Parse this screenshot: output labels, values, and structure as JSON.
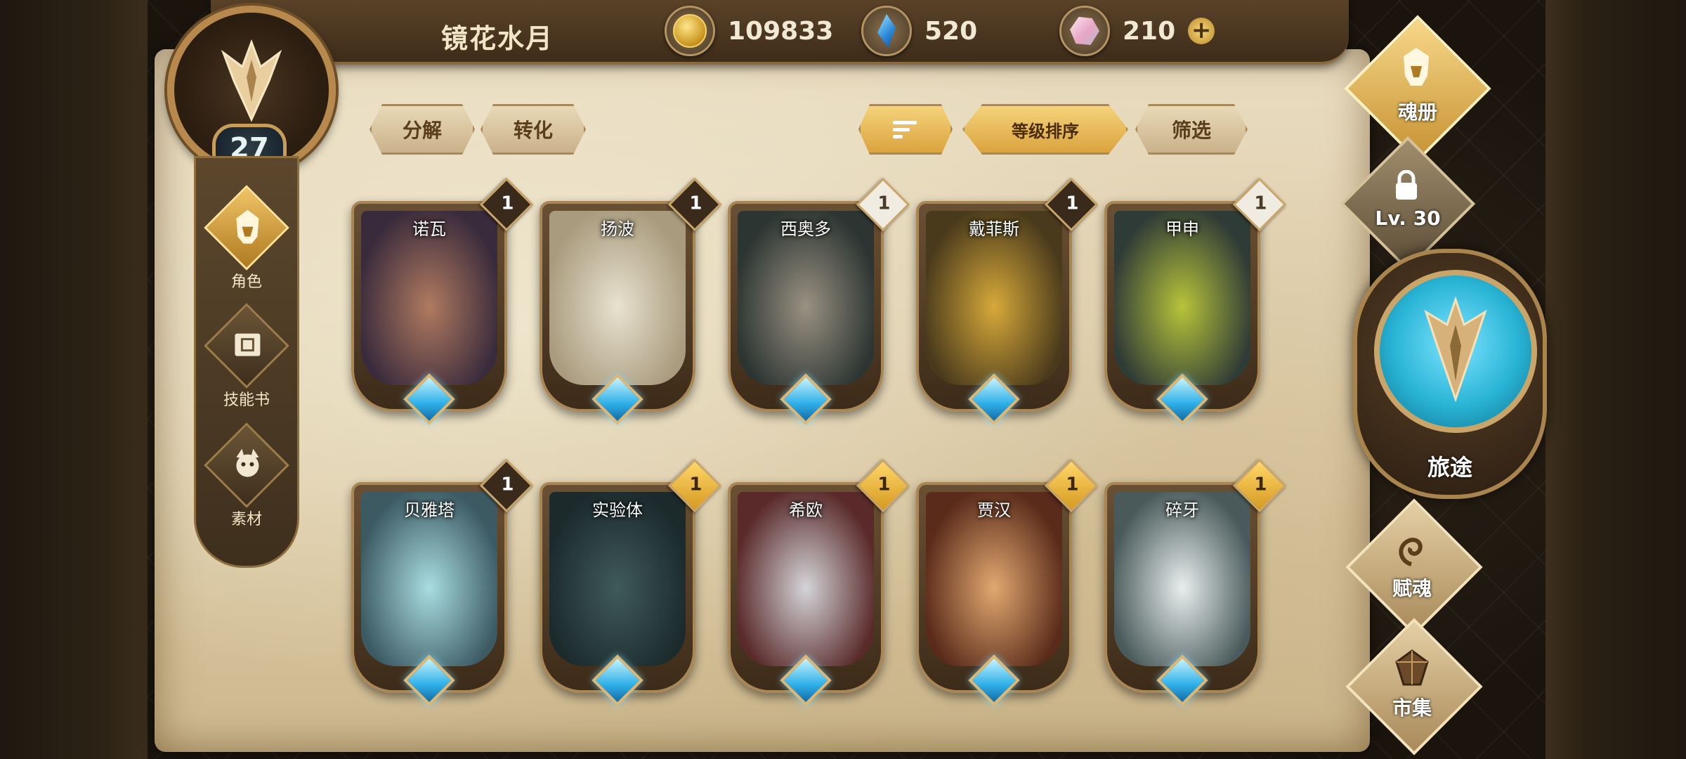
{
  "header": {
    "player_name": "镜花水月",
    "gold": "109833",
    "crystal": "520",
    "gem": "210",
    "level": "27"
  },
  "left_nav": [
    {
      "label": "角色",
      "icon": "helmet-icon",
      "active": true
    },
    {
      "label": "技能书",
      "icon": "book-icon",
      "active": false
    },
    {
      "label": "素材",
      "icon": "material-icon",
      "active": false
    }
  ],
  "actions": {
    "decompose": "分解",
    "convert": "转化",
    "sort_level": "等级排序",
    "filter": "筛选"
  },
  "cards_row1": [
    {
      "name": "诺瓦",
      "level": "1",
      "badge": "dark",
      "palette": [
        "#3a2b3c",
        "#b07a60"
      ]
    },
    {
      "name": "扬波",
      "level": "1",
      "badge": "dark",
      "palette": [
        "#a99b7e",
        "#e8e2cf"
      ]
    },
    {
      "name": "西奥多",
      "level": "1",
      "badge": "white",
      "palette": [
        "#2c3532",
        "#9a9182"
      ]
    },
    {
      "name": "戴菲斯",
      "level": "1",
      "badge": "dark",
      "palette": [
        "#4a3a1c",
        "#d6a93a"
      ]
    },
    {
      "name": "甲申",
      "level": "1",
      "badge": "white",
      "palette": [
        "#2f3b36",
        "#b7c43a"
      ]
    }
  ],
  "cards_row2": [
    {
      "name": "贝雅塔",
      "level": "1",
      "badge": "dark",
      "palette": [
        "#3d5a63",
        "#a8dde0"
      ]
    },
    {
      "name": "实验体",
      "level": "1",
      "badge": "gold",
      "palette": [
        "#1c2a2c",
        "#3f5a5a"
      ]
    },
    {
      "name": "希欧",
      "level": "1",
      "badge": "gold",
      "palette": [
        "#5a2a2a",
        "#d4d4d8"
      ]
    },
    {
      "name": "贾汉",
      "level": "1",
      "badge": "gold",
      "palette": [
        "#5a2a1a",
        "#e0a870"
      ]
    },
    {
      "name": "碎牙",
      "level": "1",
      "badge": "gold",
      "palette": [
        "#4a5a5a",
        "#e8eeee"
      ]
    }
  ],
  "right_menu": {
    "soul_book": "魂册",
    "guild_level": "Lv. 30",
    "journey": "旅途",
    "soul_grant": "赋魂",
    "market": "市集"
  },
  "colors": {
    "accent_gold": "#d9a23c",
    "parchment": "#e9dcc0",
    "journey_blue": "#29b4d6"
  }
}
